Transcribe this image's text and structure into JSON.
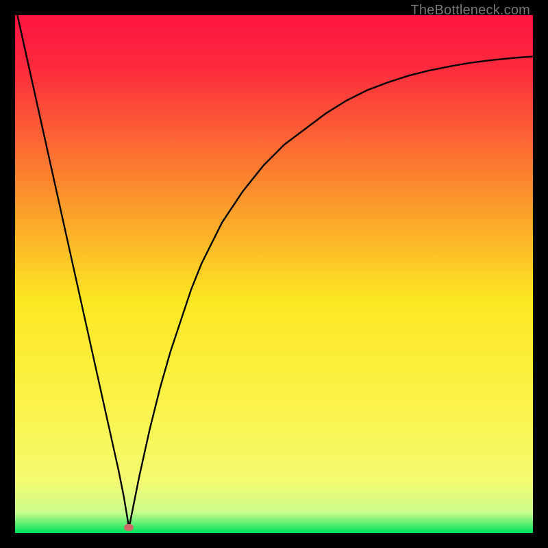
{
  "watermark": "TheBottleneck.com",
  "chart_data": {
    "type": "line",
    "title": "",
    "xlabel": "",
    "ylabel": "",
    "xlim": [
      0,
      100
    ],
    "ylim": [
      0,
      100
    ],
    "background_gradient": {
      "top": "#fd1440",
      "upper_mid": "#fb8b2d",
      "mid": "#fce722",
      "lower_mid": "#f4fb63",
      "bottom_band": "#02e35e"
    },
    "minimum_marker": {
      "x": 22,
      "y": 1,
      "color": "#cc6a6a"
    },
    "series": [
      {
        "name": "bottleneck-curve",
        "x": [
          0,
          2,
          4,
          6,
          8,
          10,
          12,
          14,
          16,
          18,
          20,
          21,
          22,
          23,
          24,
          26,
          28,
          30,
          32,
          34,
          36,
          38,
          40,
          44,
          48,
          52,
          56,
          60,
          64,
          68,
          72,
          76,
          80,
          84,
          88,
          92,
          96,
          100
        ],
        "y": [
          102,
          93,
          84,
          75,
          66,
          57,
          48,
          39,
          30,
          21,
          12,
          7,
          1,
          6,
          11,
          20,
          28,
          35,
          41,
          47,
          52,
          56,
          60,
          66,
          71,
          75,
          78,
          81,
          83.5,
          85.5,
          87,
          88.3,
          89.3,
          90.1,
          90.8,
          91.3,
          91.7,
          92
        ]
      }
    ]
  }
}
